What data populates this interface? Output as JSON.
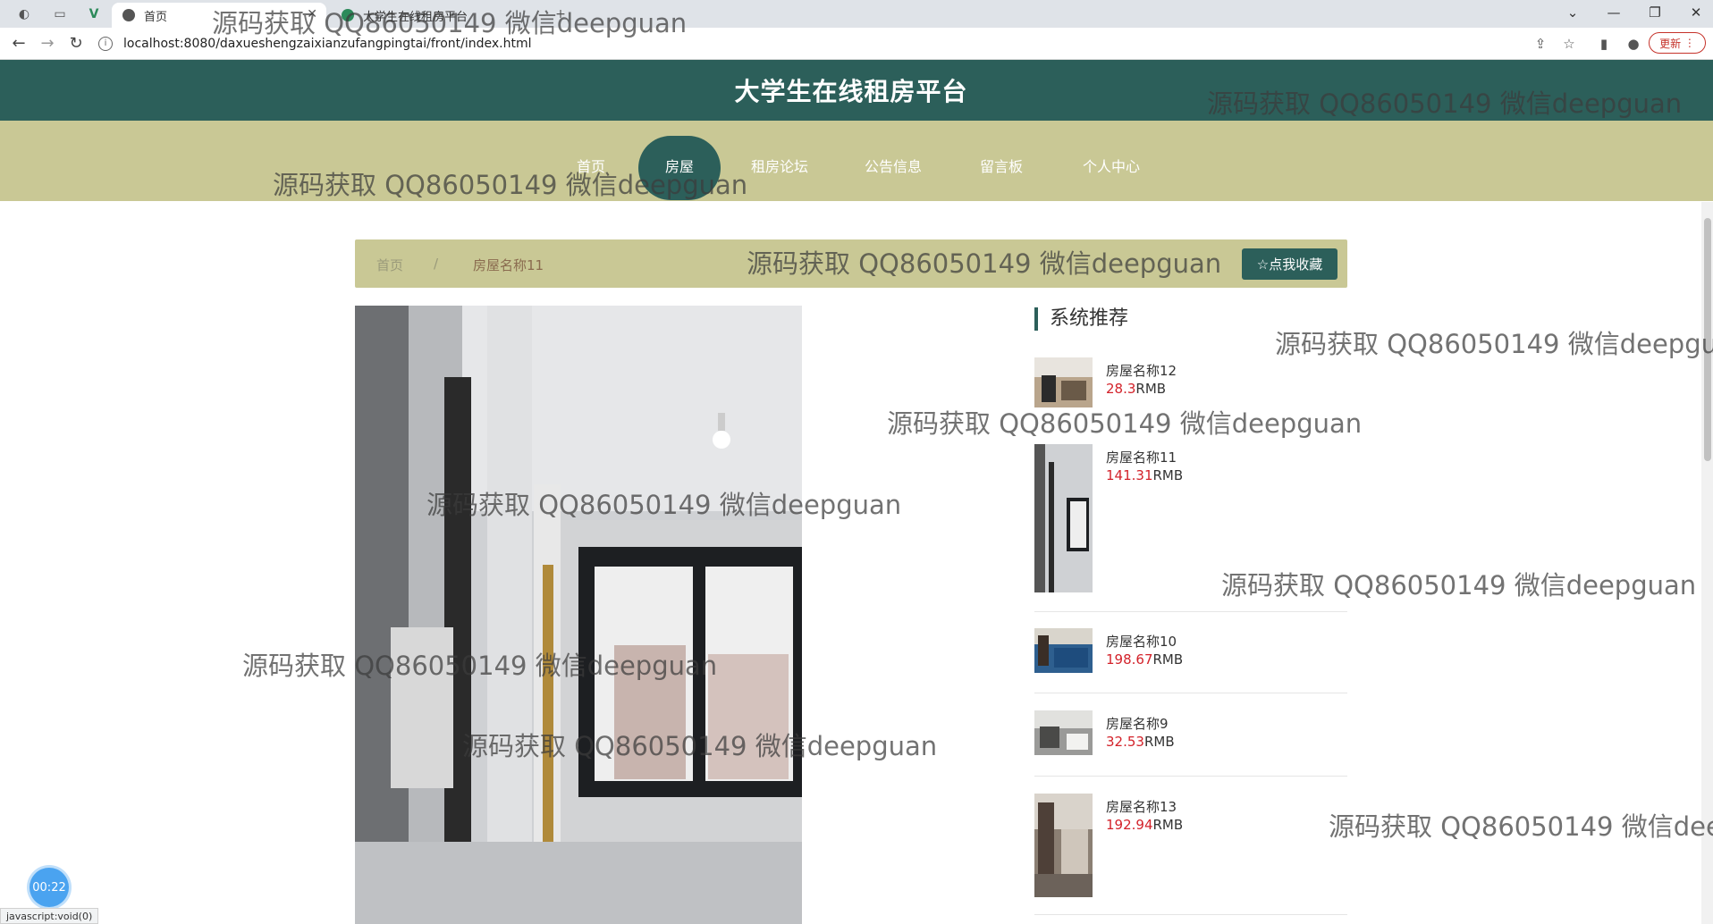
{
  "browser": {
    "tabs": [
      {
        "title": "首页",
        "active": true
      },
      {
        "title": "大学生在线租房平台",
        "active": false
      }
    ],
    "url": "localhost:8080/daxueshengzaixianzufangpingtai/front/index.html",
    "update_label": "更新",
    "status_text": "javascript:void(0)"
  },
  "site": {
    "title": "大学生在线租房平台",
    "nav": [
      {
        "label": "首页",
        "active": false
      },
      {
        "label": "房屋",
        "active": true
      },
      {
        "label": "租房论坛",
        "active": false
      },
      {
        "label": "公告信息",
        "active": false
      },
      {
        "label": "留言板",
        "active": false
      },
      {
        "label": "个人中心",
        "active": false
      }
    ]
  },
  "breadcrumb": {
    "home": "首页",
    "separator": "/",
    "current": "房屋名称11"
  },
  "collect_button": "☆点我收藏",
  "recommend": {
    "title": "系统推荐",
    "items": [
      {
        "name": "房屋名称12",
        "price": "28.3",
        "unit": "RMB"
      },
      {
        "name": "房屋名称11",
        "price": "141.31",
        "unit": "RMB"
      },
      {
        "name": "房屋名称10",
        "price": "198.67",
        "unit": "RMB"
      },
      {
        "name": "房屋名称9",
        "price": "32.53",
        "unit": "RMB"
      },
      {
        "name": "房屋名称13",
        "price": "192.94",
        "unit": "RMB"
      }
    ]
  },
  "timer": "00:22",
  "watermark_text": "源码获取 QQ86050149 微信deepguan",
  "colors": {
    "header": "#2c5f5a",
    "nav_bg": "#c9c895",
    "price": "#d3222a"
  }
}
